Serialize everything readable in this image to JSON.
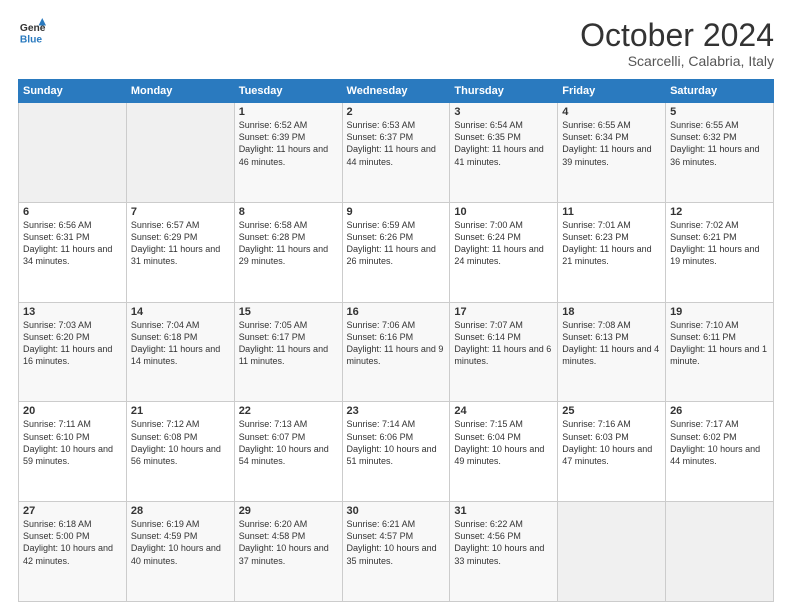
{
  "header": {
    "logo_line1": "General",
    "logo_line2": "Blue",
    "month": "October 2024",
    "location": "Scarcelli, Calabria, Italy"
  },
  "days_of_week": [
    "Sunday",
    "Monday",
    "Tuesday",
    "Wednesday",
    "Thursday",
    "Friday",
    "Saturday"
  ],
  "weeks": [
    [
      {
        "day": "",
        "sunrise": "",
        "sunset": "",
        "daylight": ""
      },
      {
        "day": "",
        "sunrise": "",
        "sunset": "",
        "daylight": ""
      },
      {
        "day": "1",
        "sunrise": "Sunrise: 6:52 AM",
        "sunset": "Sunset: 6:39 PM",
        "daylight": "Daylight: 11 hours and 46 minutes."
      },
      {
        "day": "2",
        "sunrise": "Sunrise: 6:53 AM",
        "sunset": "Sunset: 6:37 PM",
        "daylight": "Daylight: 11 hours and 44 minutes."
      },
      {
        "day": "3",
        "sunrise": "Sunrise: 6:54 AM",
        "sunset": "Sunset: 6:35 PM",
        "daylight": "Daylight: 11 hours and 41 minutes."
      },
      {
        "day": "4",
        "sunrise": "Sunrise: 6:55 AM",
        "sunset": "Sunset: 6:34 PM",
        "daylight": "Daylight: 11 hours and 39 minutes."
      },
      {
        "day": "5",
        "sunrise": "Sunrise: 6:55 AM",
        "sunset": "Sunset: 6:32 PM",
        "daylight": "Daylight: 11 hours and 36 minutes."
      }
    ],
    [
      {
        "day": "6",
        "sunrise": "Sunrise: 6:56 AM",
        "sunset": "Sunset: 6:31 PM",
        "daylight": "Daylight: 11 hours and 34 minutes."
      },
      {
        "day": "7",
        "sunrise": "Sunrise: 6:57 AM",
        "sunset": "Sunset: 6:29 PM",
        "daylight": "Daylight: 11 hours and 31 minutes."
      },
      {
        "day": "8",
        "sunrise": "Sunrise: 6:58 AM",
        "sunset": "Sunset: 6:28 PM",
        "daylight": "Daylight: 11 hours and 29 minutes."
      },
      {
        "day": "9",
        "sunrise": "Sunrise: 6:59 AM",
        "sunset": "Sunset: 6:26 PM",
        "daylight": "Daylight: 11 hours and 26 minutes."
      },
      {
        "day": "10",
        "sunrise": "Sunrise: 7:00 AM",
        "sunset": "Sunset: 6:24 PM",
        "daylight": "Daylight: 11 hours and 24 minutes."
      },
      {
        "day": "11",
        "sunrise": "Sunrise: 7:01 AM",
        "sunset": "Sunset: 6:23 PM",
        "daylight": "Daylight: 11 hours and 21 minutes."
      },
      {
        "day": "12",
        "sunrise": "Sunrise: 7:02 AM",
        "sunset": "Sunset: 6:21 PM",
        "daylight": "Daylight: 11 hours and 19 minutes."
      }
    ],
    [
      {
        "day": "13",
        "sunrise": "Sunrise: 7:03 AM",
        "sunset": "Sunset: 6:20 PM",
        "daylight": "Daylight: 11 hours and 16 minutes."
      },
      {
        "day": "14",
        "sunrise": "Sunrise: 7:04 AM",
        "sunset": "Sunset: 6:18 PM",
        "daylight": "Daylight: 11 hours and 14 minutes."
      },
      {
        "day": "15",
        "sunrise": "Sunrise: 7:05 AM",
        "sunset": "Sunset: 6:17 PM",
        "daylight": "Daylight: 11 hours and 11 minutes."
      },
      {
        "day": "16",
        "sunrise": "Sunrise: 7:06 AM",
        "sunset": "Sunset: 6:16 PM",
        "daylight": "Daylight: 11 hours and 9 minutes."
      },
      {
        "day": "17",
        "sunrise": "Sunrise: 7:07 AM",
        "sunset": "Sunset: 6:14 PM",
        "daylight": "Daylight: 11 hours and 6 minutes."
      },
      {
        "day": "18",
        "sunrise": "Sunrise: 7:08 AM",
        "sunset": "Sunset: 6:13 PM",
        "daylight": "Daylight: 11 hours and 4 minutes."
      },
      {
        "day": "19",
        "sunrise": "Sunrise: 7:10 AM",
        "sunset": "Sunset: 6:11 PM",
        "daylight": "Daylight: 11 hours and 1 minute."
      }
    ],
    [
      {
        "day": "20",
        "sunrise": "Sunrise: 7:11 AM",
        "sunset": "Sunset: 6:10 PM",
        "daylight": "Daylight: 10 hours and 59 minutes."
      },
      {
        "day": "21",
        "sunrise": "Sunrise: 7:12 AM",
        "sunset": "Sunset: 6:08 PM",
        "daylight": "Daylight: 10 hours and 56 minutes."
      },
      {
        "day": "22",
        "sunrise": "Sunrise: 7:13 AM",
        "sunset": "Sunset: 6:07 PM",
        "daylight": "Daylight: 10 hours and 54 minutes."
      },
      {
        "day": "23",
        "sunrise": "Sunrise: 7:14 AM",
        "sunset": "Sunset: 6:06 PM",
        "daylight": "Daylight: 10 hours and 51 minutes."
      },
      {
        "day": "24",
        "sunrise": "Sunrise: 7:15 AM",
        "sunset": "Sunset: 6:04 PM",
        "daylight": "Daylight: 10 hours and 49 minutes."
      },
      {
        "day": "25",
        "sunrise": "Sunrise: 7:16 AM",
        "sunset": "Sunset: 6:03 PM",
        "daylight": "Daylight: 10 hours and 47 minutes."
      },
      {
        "day": "26",
        "sunrise": "Sunrise: 7:17 AM",
        "sunset": "Sunset: 6:02 PM",
        "daylight": "Daylight: 10 hours and 44 minutes."
      }
    ],
    [
      {
        "day": "27",
        "sunrise": "Sunrise: 6:18 AM",
        "sunset": "Sunset: 5:00 PM",
        "daylight": "Daylight: 10 hours and 42 minutes."
      },
      {
        "day": "28",
        "sunrise": "Sunrise: 6:19 AM",
        "sunset": "Sunset: 4:59 PM",
        "daylight": "Daylight: 10 hours and 40 minutes."
      },
      {
        "day": "29",
        "sunrise": "Sunrise: 6:20 AM",
        "sunset": "Sunset: 4:58 PM",
        "daylight": "Daylight: 10 hours and 37 minutes."
      },
      {
        "day": "30",
        "sunrise": "Sunrise: 6:21 AM",
        "sunset": "Sunset: 4:57 PM",
        "daylight": "Daylight: 10 hours and 35 minutes."
      },
      {
        "day": "31",
        "sunrise": "Sunrise: 6:22 AM",
        "sunset": "Sunset: 4:56 PM",
        "daylight": "Daylight: 10 hours and 33 minutes."
      },
      {
        "day": "",
        "sunrise": "",
        "sunset": "",
        "daylight": ""
      },
      {
        "day": "",
        "sunrise": "",
        "sunset": "",
        "daylight": ""
      }
    ]
  ]
}
